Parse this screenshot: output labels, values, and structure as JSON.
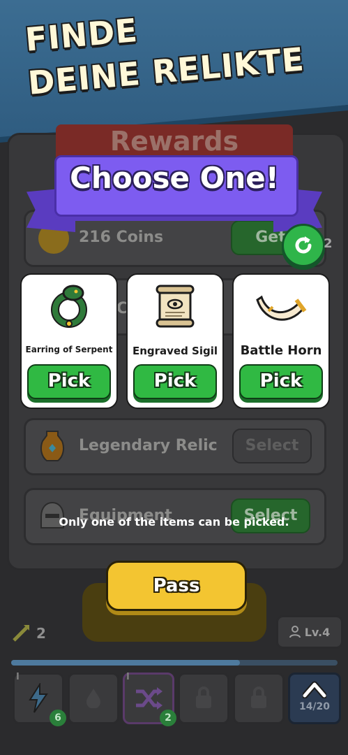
{
  "banner": {
    "line1": "FINDE",
    "line2": "DEINE RELIKTE"
  },
  "background": {
    "title": "Rewards",
    "rows": [
      {
        "label": "216 Coins",
        "button": "Get"
      },
      {
        "label": "Co"
      },
      {
        "label": "Legendary Relic",
        "button": "Select"
      },
      {
        "label": "Equipment",
        "button": "Select"
      }
    ]
  },
  "modal": {
    "title": "Choose One!",
    "refresh_count": "2",
    "cards": [
      {
        "title": "Earring of Serpent",
        "icon": "serpent-earring-icon",
        "pick_label": "Pick"
      },
      {
        "title": "Engraved Sigil",
        "icon": "scroll-sigil-icon",
        "pick_label": "Pick"
      },
      {
        "title": "Battle Horn",
        "icon": "horn-icon",
        "pick_label": "Pick"
      }
    ],
    "message": "Only one of the items can be picked.",
    "pass_label": "Pass"
  },
  "bottom_bar": {
    "attack_value": "2",
    "level_label": "Lv.4",
    "slots": [
      {
        "tier": "I",
        "badge": "6",
        "icon": "lightning-icon"
      },
      {
        "icon": "drop-icon"
      },
      {
        "tier": "I",
        "badge": "2",
        "icon": "shuffle-icon"
      },
      {
        "icon": "lock-icon"
      },
      {
        "icon": "lock-icon"
      }
    ],
    "expand_label": "14/20"
  },
  "colors": {
    "banner_blue": "#3c6d92",
    "ribbon_purple": "#7d5cf0",
    "pick_green": "#30b943",
    "pass_yellow": "#f3c531"
  }
}
